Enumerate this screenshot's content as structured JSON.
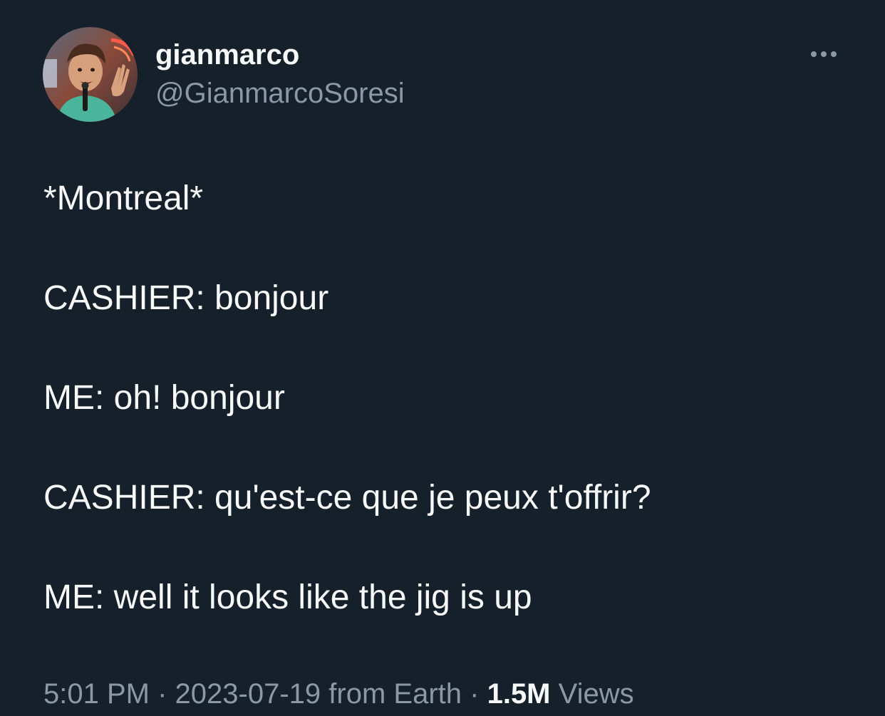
{
  "tweet": {
    "display_name": "gianmarco",
    "handle": "@GianmarcoSoresi",
    "more_icon": "more-horizontal-icon",
    "lines": [
      "*Montreal*",
      "CASHIER: bonjour",
      "ME: oh! bonjour",
      "CASHIER: qu'est-ce que je peux t'offrir?",
      "ME: well it looks like the jig is up"
    ],
    "time": "5:01 PM",
    "date": "2023-07-19",
    "source": "from Earth",
    "separator": "·",
    "views_count": "1.5M",
    "views_label": "Views"
  },
  "colors": {
    "background": "#15202b",
    "text_primary": "#f7f9f9",
    "text_secondary": "#8b98a5"
  }
}
